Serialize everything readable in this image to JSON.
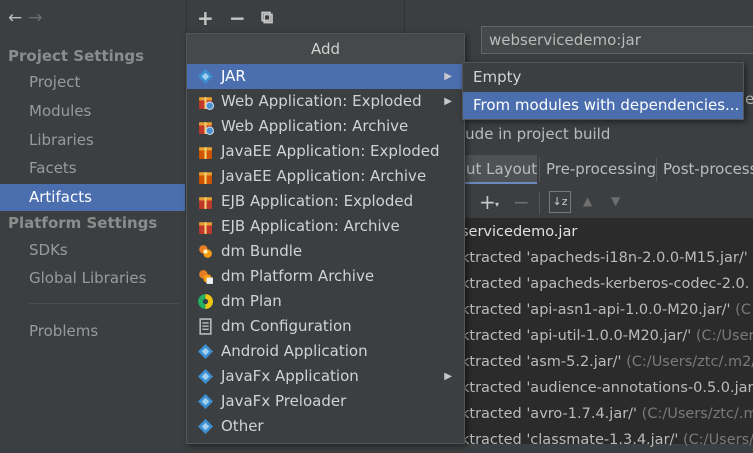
{
  "sidebar": {
    "back_arrow": "←",
    "forward_arrow": "→",
    "project_settings_heading": "Project Settings",
    "project_items": [
      "Project",
      "Modules",
      "Libraries",
      "Facets",
      "Artifacts"
    ],
    "platform_settings_heading": "Platform Settings",
    "platform_items": [
      "SDKs",
      "Global Libraries"
    ],
    "problems": "Problems",
    "selected": "Artifacts"
  },
  "toolbar": {
    "add": "+",
    "remove": "−",
    "copy": "⧉"
  },
  "popup": {
    "title": "Add",
    "items": [
      {
        "label": "JAR",
        "icon": "jar-icon",
        "submenu": true,
        "selected": true
      },
      {
        "label": "Web Application: Exploded",
        "icon": "web-app-icon",
        "submenu": true
      },
      {
        "label": "Web Application: Archive",
        "icon": "web-app-icon"
      },
      {
        "label": "JavaEE Application: Exploded",
        "icon": "javaee-icon"
      },
      {
        "label": "JavaEE Application: Archive",
        "icon": "javaee-icon"
      },
      {
        "label": "EJB Application: Exploded",
        "icon": "ejb-icon"
      },
      {
        "label": "EJB Application: Archive",
        "icon": "ejb-icon"
      },
      {
        "label": "dm Bundle",
        "icon": "dm-bundle-icon"
      },
      {
        "label": "dm Platform Archive",
        "icon": "dm-archive-icon"
      },
      {
        "label": "dm Plan",
        "icon": "dm-plan-icon"
      },
      {
        "label": "dm Configuration",
        "icon": "dm-config-icon"
      },
      {
        "label": "Android Application",
        "icon": "android-icon"
      },
      {
        "label": "JavaFx Application",
        "icon": "javafx-icon",
        "submenu": true
      },
      {
        "label": "JavaFx Preloader",
        "icon": "javafx-icon"
      },
      {
        "label": "Other",
        "icon": "other-icon"
      }
    ]
  },
  "submenu": {
    "items": [
      "Empty",
      "From modules with dependencies..."
    ],
    "selected": "From modules with dependencies..."
  },
  "right_panel": {
    "name_value": "webservicedemo:jar",
    "type_label_fragment": "e",
    "include_label": "lude in project build",
    "tabs": [
      "ut Layout",
      "Pre-processing",
      "Post-process"
    ],
    "tree": [
      {
        "text": "servicedemo.jar",
        "path": ""
      },
      {
        "text": "ktracted 'apacheds-i18n-2.0.0-M15.jar/'",
        "path": " (C"
      },
      {
        "text": "ktracted 'apacheds-kerberos-codec-2.0.",
        "path": ""
      },
      {
        "text": "ktracted 'api-asn1-api-1.0.0-M20.jar/'",
        "path": " (C"
      },
      {
        "text": "ktracted 'api-util-1.0.0-M20.jar/'",
        "path": " (C:/User"
      },
      {
        "text": "ktracted 'asm-5.2.jar/'",
        "path": " (C:/Users/ztc/.m2/"
      },
      {
        "text": "ktracted 'audience-annotations-0.5.0.jar",
        "path": ""
      },
      {
        "text": "ktracted 'avro-1.7.4.jar/'",
        "path": " (C:/Users/ztc/.m"
      },
      {
        "text": "ktracted 'classmate-1.3.4.jar/'",
        "path": " (C:/Users/"
      }
    ]
  }
}
